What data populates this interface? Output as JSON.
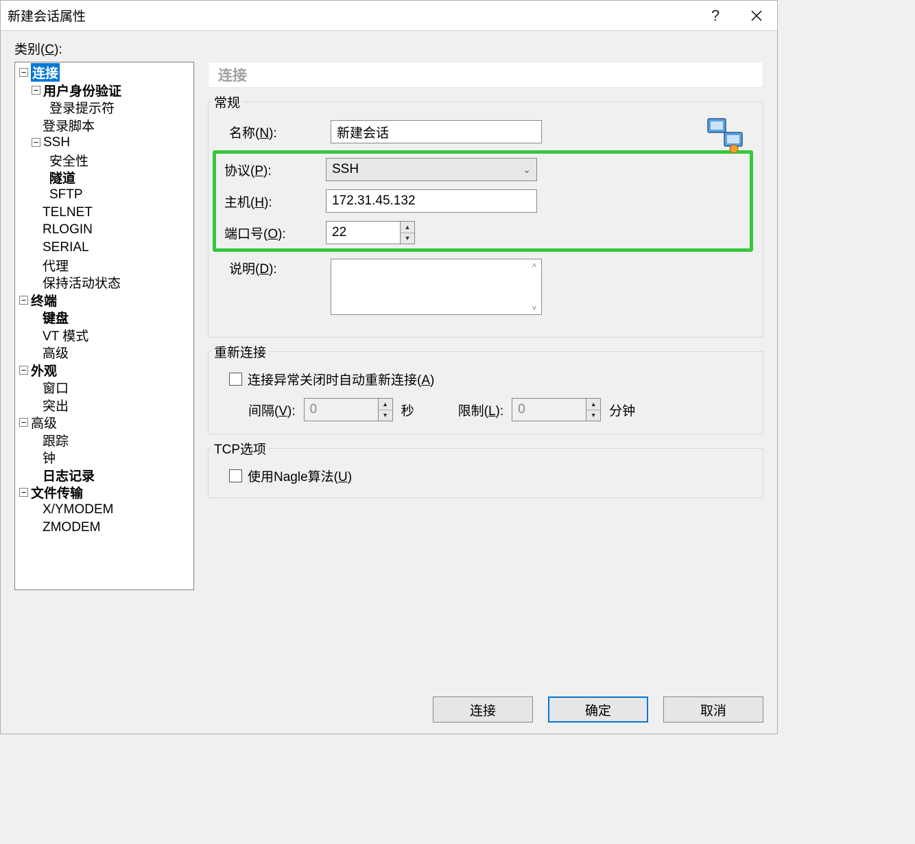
{
  "window": {
    "title": "新建会话属性"
  },
  "category_label_pre": "类别(",
  "category_label_u": "C",
  "category_label_post": "):",
  "tree": {
    "connection": "连接",
    "auth": "用户身份验证",
    "login_prompt": "登录提示符",
    "login_script": "登录脚本",
    "ssh": "SSH",
    "security": "安全性",
    "tunnel": "隧道",
    "sftp": "SFTP",
    "telnet": "TELNET",
    "rlogin": "RLOGIN",
    "serial": "SERIAL",
    "proxy": "代理",
    "keepalive": "保持活动状态",
    "terminal": "终端",
    "keyboard": "键盘",
    "vtmode": "VT 模式",
    "advanced_term": "高级",
    "appearance": "外观",
    "window": "窗口",
    "highlight": "突出",
    "advanced": "高级",
    "trace": "跟踪",
    "bell": "钟",
    "logging": "日志记录",
    "file_transfer": "文件传输",
    "xymodem": "X/YMODEM",
    "zmodem": "ZMODEM"
  },
  "panel_title": "连接",
  "general": {
    "title": "常规",
    "name_label": "名称(N):",
    "name_value": "新建会话",
    "protocol_label": "协议(P):",
    "protocol_value": "SSH",
    "host_label": "主机(H):",
    "host_value": "172.31.45.132",
    "port_label": "端口号(O):",
    "port_value": "22",
    "desc_label": "说明(D):"
  },
  "reconnect": {
    "title": "重新连接",
    "checkbox_label": "连接异常关闭时自动重新连接(A)",
    "interval_label": "间隔(V):",
    "interval_value": "0",
    "interval_unit": "秒",
    "limit_label": "限制(L):",
    "limit_value": "0",
    "limit_unit": "分钟"
  },
  "tcp": {
    "title": "TCP选项",
    "nagle_label": "使用Nagle算法(U)"
  },
  "buttons": {
    "connect": "连接",
    "ok": "确定",
    "cancel": "取消"
  }
}
